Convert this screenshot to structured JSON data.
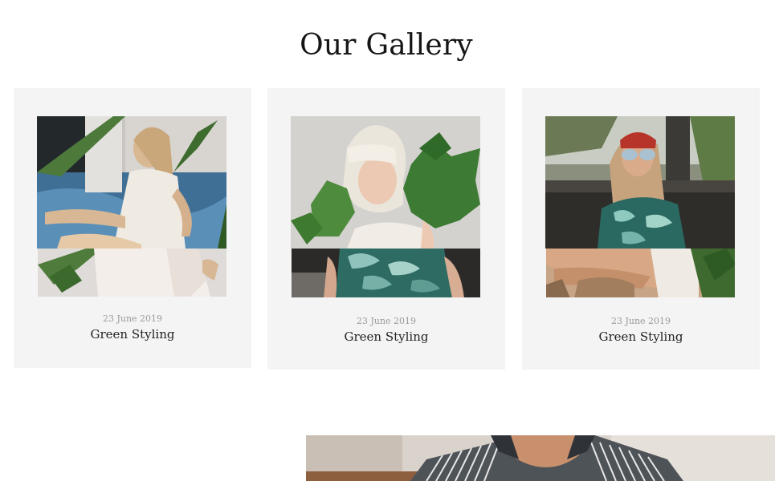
{
  "section": {
    "title": "Our Gallery"
  },
  "gallery": {
    "items": [
      {
        "date": "23 June 2019",
        "title": "Green Styling",
        "image": "woman-white-dress-by-pool"
      },
      {
        "date": "23 June 2019",
        "title": "Green Styling",
        "image": "blonde-woman-with-leaves"
      },
      {
        "date": "23 June 2019",
        "title": "Green Styling",
        "image": "woman-red-beanie-sunglasses"
      }
    ]
  },
  "banner": {
    "image": "man-striped-shirt"
  }
}
